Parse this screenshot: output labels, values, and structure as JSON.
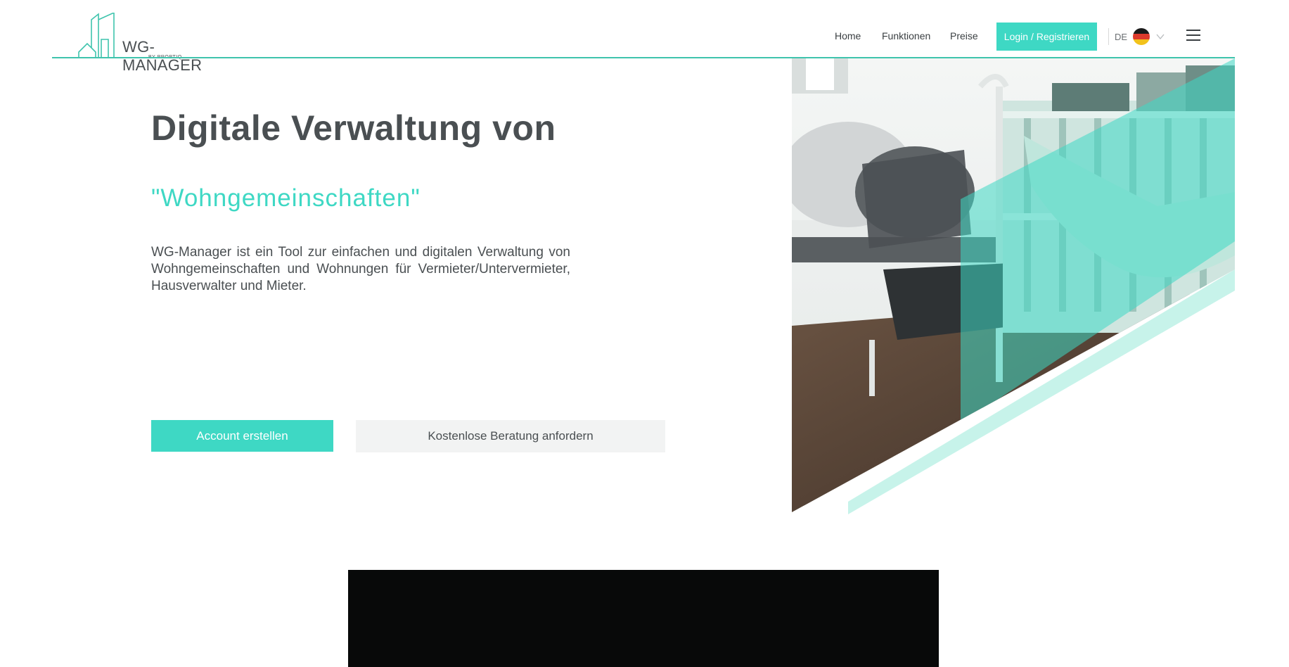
{
  "header": {
    "logo_text": "WG-MANAGER",
    "logo_sub": "BY PROPTIQ",
    "nav": {
      "home": "Home",
      "funktionen": "Funktionen",
      "preise": "Preise"
    },
    "login_label": "Login / Registrieren",
    "language_code": "DE",
    "flag_icon": "germany-flag-icon",
    "menu_icon": "hamburger-menu-icon"
  },
  "hero": {
    "title": "Digitale Verwaltung von",
    "subtitle": "\"Wohngemeinschaften\"",
    "description": "WG-Manager ist ein Tool zur einfachen und digitalen Verwaltung von Wohngemeinschaften und Wohnungen für Vermieter/Untervermieter, Hausverwalter und Mieter.",
    "primary_button": "Account erstellen",
    "secondary_button": "Kostenlose Beratung anfordern"
  },
  "colors": {
    "accent": "#3ed8c4",
    "text": "#4a4f52",
    "secondary_button_bg": "#f2f3f3",
    "video_bg": "#080909"
  }
}
